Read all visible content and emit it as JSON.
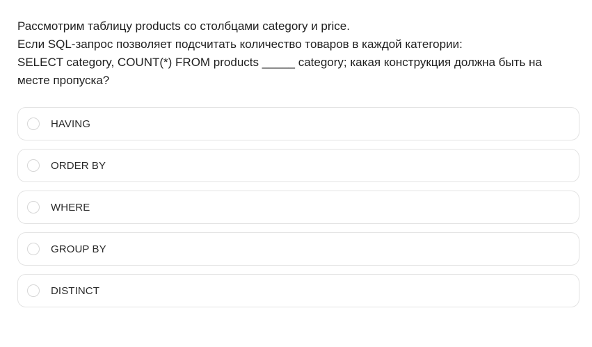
{
  "question": {
    "lines": [
      "Рассмотрим таблицу products со столбцами category и price.",
      "Если SQL-запрос позволяет подсчитать количество товаров в каждой категории:",
      "SELECT category, COUNT(*) FROM products _____ category; какая конструкция должна быть на",
      "месте пропуска?"
    ]
  },
  "options": [
    {
      "label": "HAVING"
    },
    {
      "label": "ORDER BY"
    },
    {
      "label": "WHERE"
    },
    {
      "label": "GROUP BY"
    },
    {
      "label": "DISTINCT"
    }
  ]
}
